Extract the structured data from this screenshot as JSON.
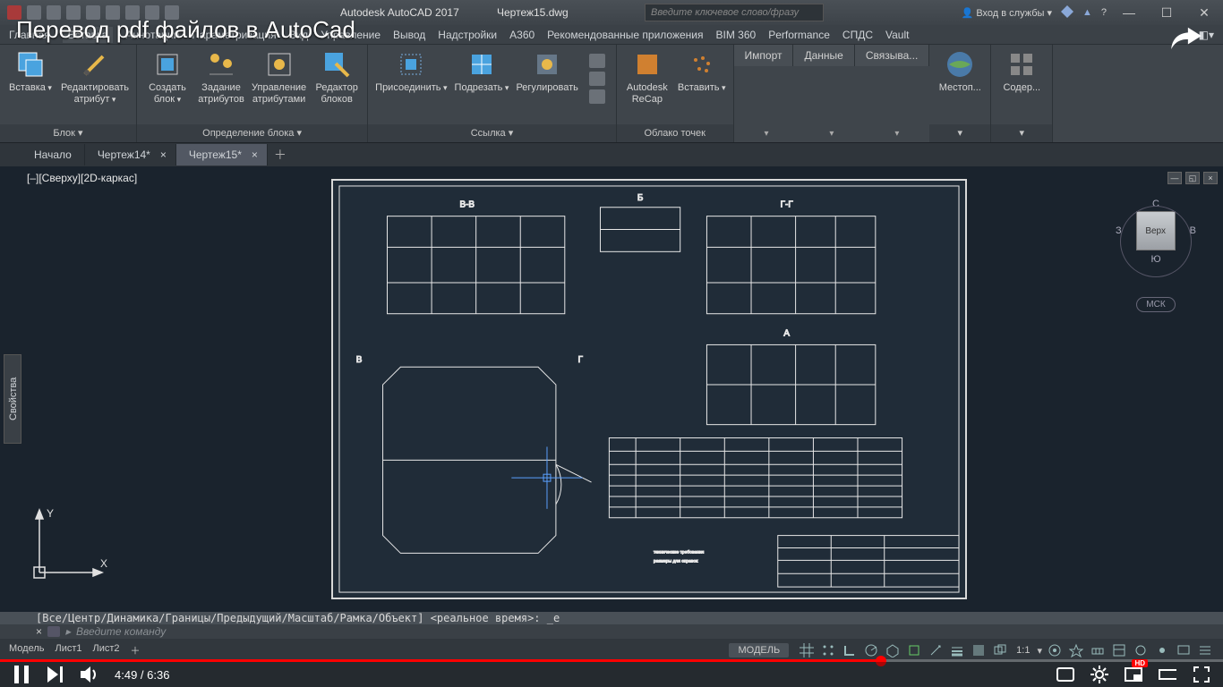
{
  "overlay": {
    "title": "Перевод pdf файлов в AutoCad"
  },
  "titlebar": {
    "app": "Autodesk AutoCAD 2017",
    "file": "Чертеж15.dwg",
    "search_placeholder": "Введите ключевое слово/фразу",
    "signin": "Вход в службы"
  },
  "menubar": {
    "items": [
      "Главная",
      "Вставка",
      "Аннотации",
      "Параметризация",
      "Вид",
      "Управление",
      "Вывод",
      "Надстройки",
      "A360",
      "Рекомендованные приложения",
      "BIM 360",
      "Performance",
      "СПДС",
      "Vault"
    ]
  },
  "ribbon": {
    "panel_block": {
      "title": "Блок ▾",
      "btns": [
        {
          "l": "Вставка",
          "d": true
        },
        {
          "l": "Редактировать\nатрибут",
          "d": true
        }
      ]
    },
    "panel_def": {
      "title": "Определение блока ▾",
      "btns": [
        {
          "l": "Создать\nблок",
          "d": true
        },
        {
          "l": "Задание\nатрибутов"
        },
        {
          "l": "Управление\nатрибутами"
        },
        {
          "l": "Редактор\nблоков"
        }
      ]
    },
    "panel_ref": {
      "title": "Ссылка ▾",
      "btns": [
        {
          "l": "Присоединить",
          "d": true
        },
        {
          "l": "Подрезать",
          "d": true
        },
        {
          "l": "Регулировать"
        }
      ]
    },
    "panel_cloud": {
      "title": "Облако точек",
      "btns": [
        {
          "l": "Autodesk\nReCap"
        },
        {
          "l": "Вставить",
          "d": true
        }
      ]
    },
    "tabs": [
      {
        "l": "Импорт"
      },
      {
        "l": "Данные"
      },
      {
        "l": "Связыва..."
      }
    ],
    "panel_loc": {
      "title": "",
      "btns": [
        {
          "l": "Местоп..."
        }
      ]
    },
    "panel_cont": {
      "title": "",
      "btns": [
        {
          "l": "Содер..."
        }
      ]
    }
  },
  "filetabs": {
    "start": "Начало",
    "tabs": [
      {
        "l": "Чертеж14*"
      },
      {
        "l": "Чертеж15*",
        "active": true
      }
    ]
  },
  "canvas": {
    "view_label": "[–][Сверху][2D-каркас]",
    "ucs": {
      "x": "X",
      "y": "Y"
    },
    "sections": {
      "bv": "В-В",
      "b": "Б",
      "gg": "Г-Г",
      "a": "А",
      "v": "В",
      "g": "Г"
    },
    "viewcube": {
      "top": "С",
      "left": "З",
      "right": "В",
      "bottom": "Ю",
      "face": "Верх",
      "msk": "МСК"
    }
  },
  "props": "Свойства",
  "cmd": {
    "history": "[Все/Центр/Динамика/Границы/Предыдущий/Масштаб/Рамка/Объект] <реальное время>: _e",
    "placeholder": "Введите команду"
  },
  "statusbar": {
    "left": [
      "Модель",
      "Лист1",
      "Лист2"
    ],
    "model": "МОДЕЛЬ",
    "scale": "1:1"
  },
  "player": {
    "current": "4:49",
    "duration": "6:36"
  }
}
